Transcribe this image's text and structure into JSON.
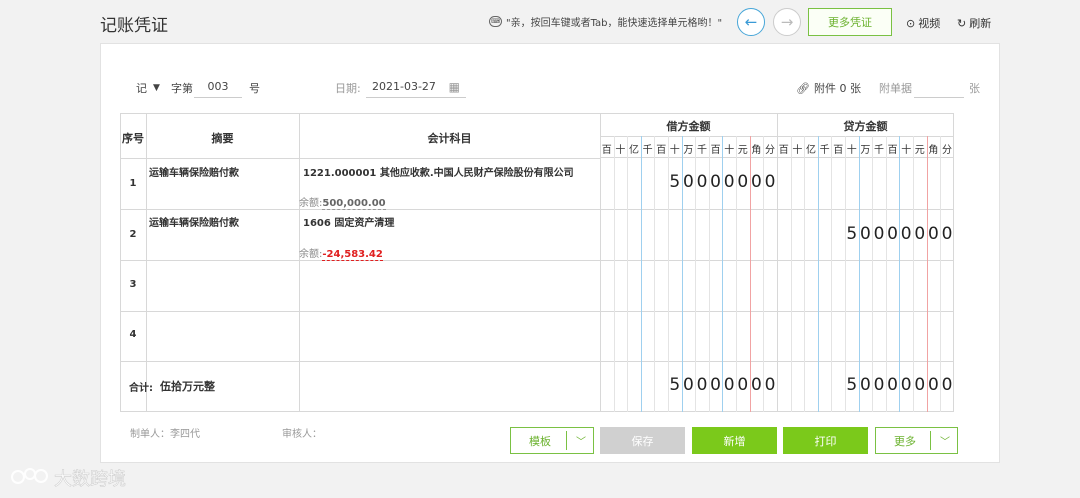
{
  "page": {
    "title": "记账凭证"
  },
  "topbar": {
    "tip_icon": "keyboard-icon",
    "tip": "\"亲，按回车键或者Tab，能快速选择单元格哟！\"",
    "more_voucher": "更多凭证",
    "video": "视频",
    "refresh": "刷新"
  },
  "voucher_header": {
    "word": "记",
    "zi_label": "字第",
    "number": "003",
    "hao_label": "号",
    "date_label": "日期:",
    "date": "2021-03-27",
    "attachment": "附件 0 张",
    "attachment_docs_label": "附单据",
    "zhang_label": "张"
  },
  "table": {
    "headers": {
      "no": "序号",
      "summary": "摘要",
      "account": "会计科目",
      "debit": "借方金额",
      "credit": "贷方金额"
    },
    "digit_units": [
      "百",
      "十",
      "亿",
      "千",
      "百",
      "十",
      "万",
      "千",
      "百",
      "十",
      "元",
      "角",
      "分"
    ],
    "balance_label": "余额:",
    "rows": [
      {
        "no": "1",
        "summary": "运输车辆保险赔付款",
        "account": "1221.000001 其他应收款.中国人民财产保险股份有限公司",
        "balance": "500,000.00",
        "debit": "50000000",
        "credit": ""
      },
      {
        "no": "2",
        "summary": "运输车辆保险赔付款",
        "account": "1606 固定资产清理",
        "balance": "-24,583.42",
        "debit": "",
        "credit": "50000000"
      },
      {
        "no": "3",
        "summary": "",
        "account": "",
        "balance": "",
        "debit": "",
        "credit": ""
      },
      {
        "no": "4",
        "summary": "",
        "account": "",
        "balance": "",
        "debit": "",
        "credit": ""
      }
    ],
    "total_label": "合计:",
    "total_in_words": "伍拾万元整",
    "total_debit": "50000000",
    "total_credit": "50000000"
  },
  "footer": {
    "maker": "制单人：李四代",
    "auditor": "审核人：",
    "template": "模板",
    "save": "保存",
    "new": "新增",
    "print": "打印",
    "more": "更多"
  },
  "watermark": {
    "text": "大数跨境"
  },
  "colors": {
    "accent_green": "#7bc91b",
    "link_blue": "#3a9ad6",
    "negative_red": "#e02020"
  }
}
